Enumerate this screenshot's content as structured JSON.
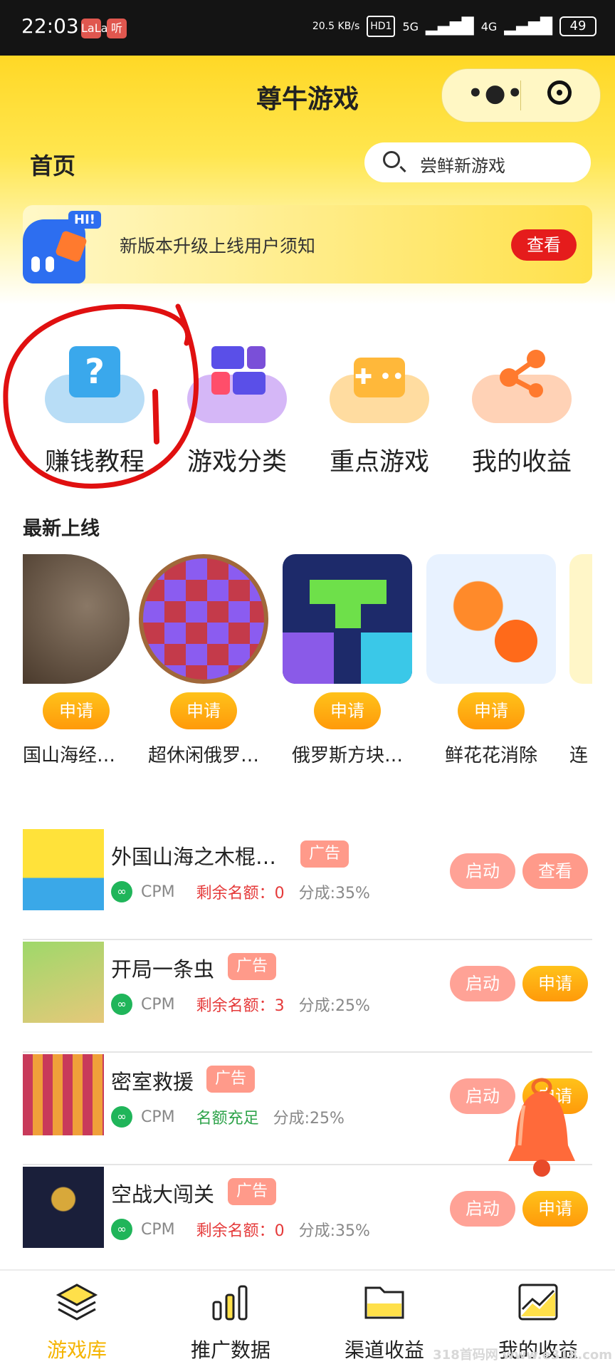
{
  "status_bar": {
    "time": "22:03",
    "badges": [
      "LaLa",
      "听"
    ],
    "net_speed": "20.5 KB/s",
    "hd": "HD1",
    "sig5g": "5G",
    "sig4g": "4G",
    "battery": "49"
  },
  "header": {
    "title": "尊牛游戏",
    "page_title": "首页",
    "search_placeholder": "尝鲜新游戏"
  },
  "notice": {
    "hi": "HI!",
    "text": "新版本升级上线用户须知",
    "button": "查看"
  },
  "quick_entries": [
    {
      "label": "赚钱教程",
      "icon": "question-bag-icon",
      "color": "#69b7f0"
    },
    {
      "label": "游戏分类",
      "icon": "category-grid-icon",
      "color": "#b17cf2"
    },
    {
      "label": "重点游戏",
      "icon": "gamepad-icon",
      "color": "#ffb84a"
    },
    {
      "label": "我的收益",
      "icon": "share-nodes-icon",
      "color": "#ff8c4a"
    }
  ],
  "latest": {
    "title": "最新上线",
    "apply_label": "申请",
    "games": [
      {
        "name": "国山海经…"
      },
      {
        "name": "超休闲俄罗…"
      },
      {
        "name": "俄罗斯方块…"
      },
      {
        "name": "鲜花花消除"
      },
      {
        "name": "连"
      }
    ]
  },
  "game_list": [
    {
      "title": "外国山海之木棍…",
      "tag": "广告",
      "type": "CPM",
      "quota": "剩余名额：0",
      "quota_status": "red",
      "share": "分成:35%",
      "btn_a": "启动",
      "btn_b": "查看",
      "btn_b_color": "#ff9a8a"
    },
    {
      "title": "开局一条虫",
      "tag": "广告",
      "type": "CPM",
      "quota": "剩余名额：3",
      "quota_status": "red",
      "share": "分成:25%",
      "btn_a": "启动",
      "btn_b": "申请",
      "btn_b_color": "#ffb010"
    },
    {
      "title": "密室救援",
      "tag": "广告",
      "type": "CPM",
      "quota": "名额充足",
      "quota_status": "green",
      "share": "分成:25%",
      "btn_a": "启动",
      "btn_b": "申请",
      "btn_b_color": "#ffb010"
    },
    {
      "title": "空战大闯关",
      "tag": "广告",
      "type": "CPM",
      "quota": "剩余名额：0",
      "quota_status": "red",
      "share": "分成:35%",
      "btn_a": "启动",
      "btn_b": "申请",
      "btn_b_color": "#ffb010"
    }
  ],
  "bottom_nav": [
    {
      "label": "游戏库",
      "icon": "stack-layers-icon",
      "active": true
    },
    {
      "label": "推广数据",
      "icon": "bar-chart-icon",
      "active": false
    },
    {
      "label": "渠道收益",
      "icon": "folder-icon",
      "active": false
    },
    {
      "label": "我的收益",
      "icon": "trend-chart-icon",
      "active": false
    }
  ],
  "colors": {
    "brand_yellow": "#ffd826",
    "active_nav": "#f5b400",
    "alert_red": "#e51c1c"
  },
  "watermark": "318首码网 www.e318.com"
}
